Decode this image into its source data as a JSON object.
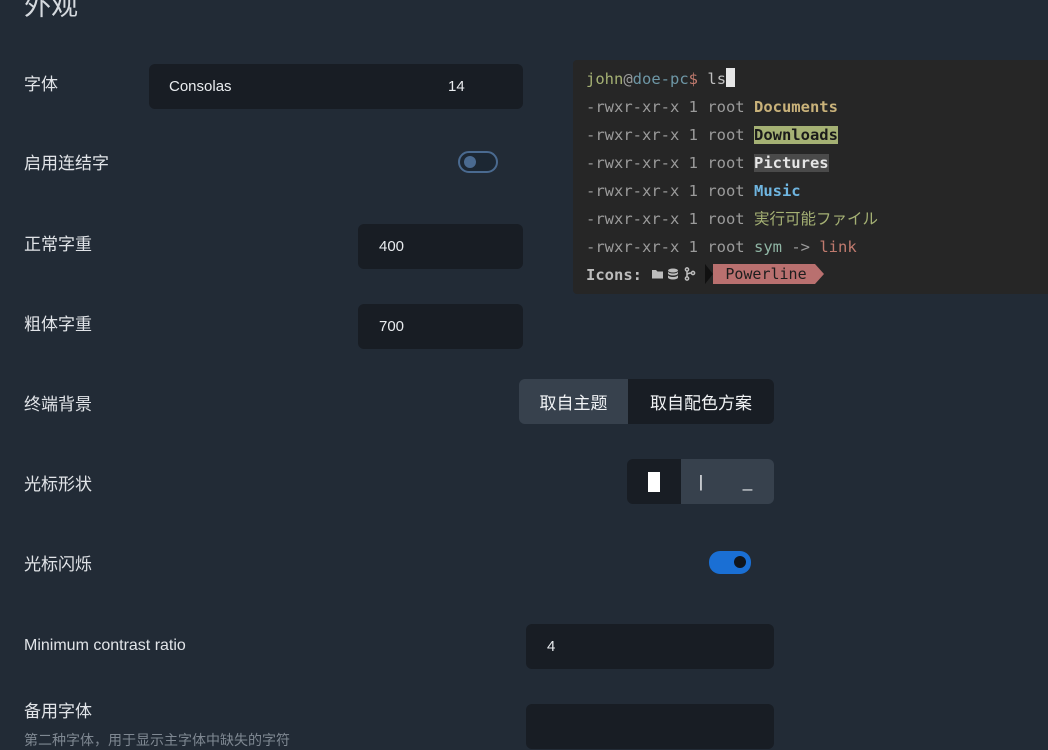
{
  "section_title": "外观",
  "font": {
    "label": "字体",
    "family": "Consolas",
    "size": "14"
  },
  "ligatures": {
    "label": "启用连结字",
    "enabled": false
  },
  "normal_weight": {
    "label": "正常字重",
    "value": "400"
  },
  "bold_weight": {
    "label": "粗体字重",
    "value": "700"
  },
  "terminal_background": {
    "label": "终端背景",
    "options": [
      "取自主题",
      "取自配色方案"
    ],
    "selected": "取自主题"
  },
  "cursor_shape": {
    "label": "光标形状",
    "options": [
      "█",
      "|",
      "_"
    ],
    "selected": "█"
  },
  "cursor_blink": {
    "label": "光标闪烁",
    "enabled": true
  },
  "min_contrast": {
    "label": "Minimum contrast ratio",
    "value": "4"
  },
  "fallback_font": {
    "label": "备用字体",
    "description": "第二种字体，用于显示主字体中缺失的字符",
    "value": ""
  },
  "terminal_preview": {
    "user": "john",
    "at": "@",
    "host": "doe-pc",
    "prompt": "$",
    "command": "ls",
    "perm": "-rwxr-xr-x 1 root",
    "entries": [
      "Documents",
      "Downloads",
      "Pictures",
      "Music",
      "実行可能ファイル",
      "sym",
      "->",
      "link"
    ],
    "icons_label": "Icons:",
    "icons": [
      "folder-icon",
      "database-icon",
      "git-branch-icon"
    ],
    "powerline_label": "Powerline"
  },
  "colors": {
    "background": "#222b36",
    "input_bg": "#181d24",
    "accent": "#1a6fd4",
    "segment_active": "#37414d",
    "terminal_bg": "#262626",
    "powerline": "#b9706f"
  }
}
